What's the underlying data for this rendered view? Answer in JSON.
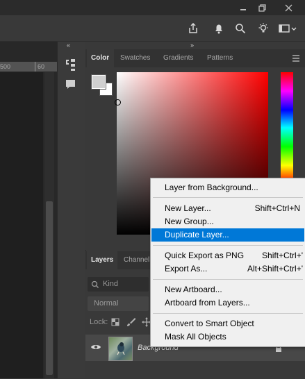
{
  "ruler": {
    "tick_a": "500",
    "tick_b": "60"
  },
  "tabs": {
    "color": "Color",
    "swatches": "Swatches",
    "gradients": "Gradients",
    "patterns": "Patterns"
  },
  "layers": {
    "tab_layers": "Layers",
    "tab_channels": "Channel",
    "filter_kind": "Kind",
    "blend_mode": "Normal",
    "lock_label": "Lock:",
    "layer_name": "Background"
  },
  "menu": {
    "layer_from_background": "Layer from Background...",
    "new_layer": "New Layer...",
    "new_layer_shortcut": "Shift+Ctrl+N",
    "new_group": "New Group...",
    "duplicate_layer": "Duplicate Layer...",
    "quick_export": "Quick Export as PNG",
    "quick_export_shortcut": "Shift+Ctrl+'",
    "export_as": "Export As...",
    "export_as_shortcut": "Alt+Shift+Ctrl+'",
    "new_artboard": "New Artboard...",
    "artboard_from_layers": "Artboard from Layers...",
    "convert_smart_object": "Convert to Smart Object",
    "mask_all_objects": "Mask All Objects"
  },
  "colors": {
    "menu_highlight": "#0078d7",
    "panel_bg": "#393939",
    "foreground_swatch": "#d0d0d0",
    "background_swatch": "#ffffff"
  }
}
